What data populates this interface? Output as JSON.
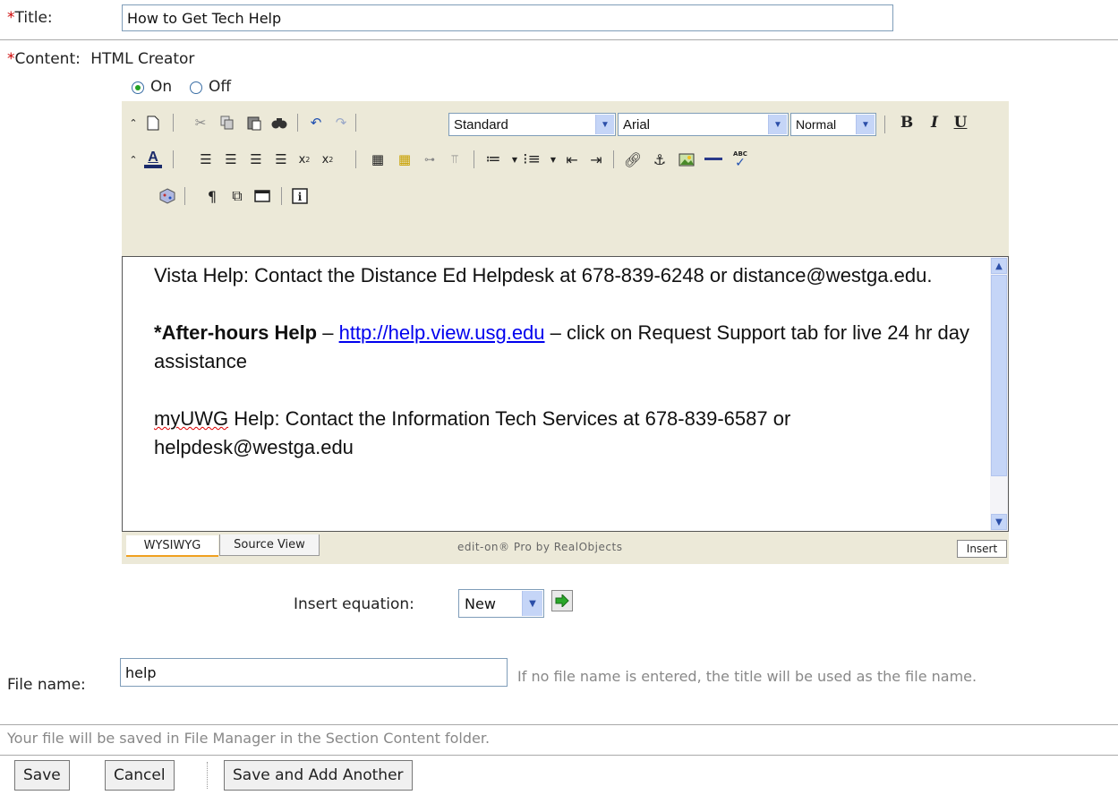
{
  "title_field": {
    "label": "Title:",
    "value": "How to Get Tech Help"
  },
  "content_field": {
    "label": "Content:",
    "creator_label": "HTML Creator",
    "mode_on": "On",
    "mode_off": "Off",
    "selected_mode": "On"
  },
  "toolbar": {
    "style_select": "Standard",
    "font_select": "Arial",
    "size_select": "Normal",
    "bold": "B",
    "italic": "I",
    "underline": "U"
  },
  "editor_content": {
    "line1": "Vista Help: Contact the Distance Ed Helpdesk at 678-839-6248 or distance@westga.edu.",
    "after_hours_prefix": "*",
    "after_hours_bold": "After-hours Help",
    "after_hours_dash1": " – ",
    "after_hours_link": "http://help.view.usg.edu",
    "after_hours_rest": " – click on Request Support tab for live 24 hr day assistance",
    "myuwg_word": "myUWG",
    "myuwg_rest": " Help: Contact the Information Tech Services at 678-839-6587 or helpdesk@westga.edu"
  },
  "editor_tabs": {
    "wysiwyg": "WYSIWYG",
    "source": "Source View"
  },
  "editor_credit": "edit-on® Pro by RealObjects",
  "editor_mode_indicator": "Insert",
  "equation": {
    "label": "Insert equation:",
    "selected": "New"
  },
  "file_name": {
    "label": "File name:",
    "value": "help",
    "hint": "If no file name is entered, the title will be used as the file name."
  },
  "save_note": "Your file will be saved in File Manager in the Section Content folder.",
  "buttons": {
    "save": "Save",
    "cancel": "Cancel",
    "save_add": "Save and Add Another"
  }
}
